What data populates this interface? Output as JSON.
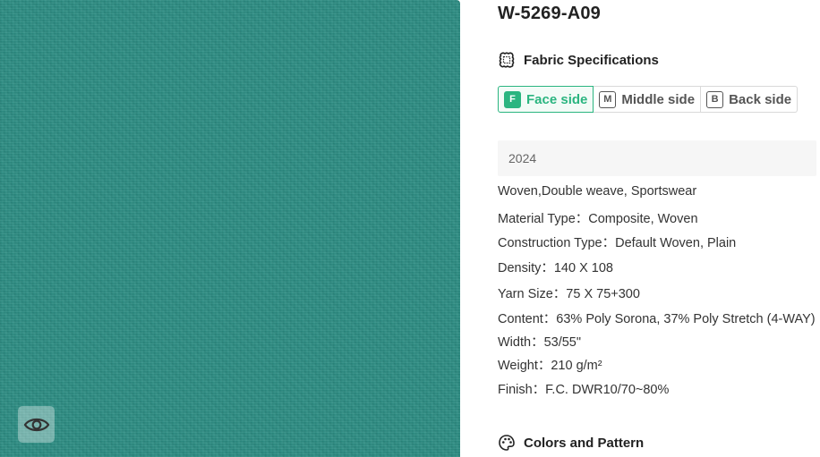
{
  "product": {
    "code": "W-5269-A09"
  },
  "swatch": {
    "color": "#2c8d83",
    "view_icon": "eye-icon"
  },
  "specifications": {
    "heading": "Fabric Specifications",
    "icon": "fabric-patch-icon",
    "sides": [
      {
        "letter": "F",
        "label": "Face side",
        "active": true
      },
      {
        "letter": "M",
        "label": "Middle side",
        "active": false
      },
      {
        "letter": "B",
        "label": "Back side",
        "active": false
      }
    ],
    "accent_color": "#2bb580",
    "year": "2024",
    "details": [
      "Woven,Double weave, Sportswear",
      "Material Type：Composite, Woven",
      "Construction Type：Default Woven, Plain",
      "Density：140 X 108",
      "Yarn Size：75 X 75+300",
      "Content：63% Poly Sorona, 37% Poly Stretch (4-WAY)",
      "Width：53/55\"",
      "Weight：210 g/m²",
      "Finish：F.C. DWR10/70~80%"
    ]
  },
  "colors": {
    "heading": "Colors and Pattern",
    "icon": "palette-icon"
  }
}
